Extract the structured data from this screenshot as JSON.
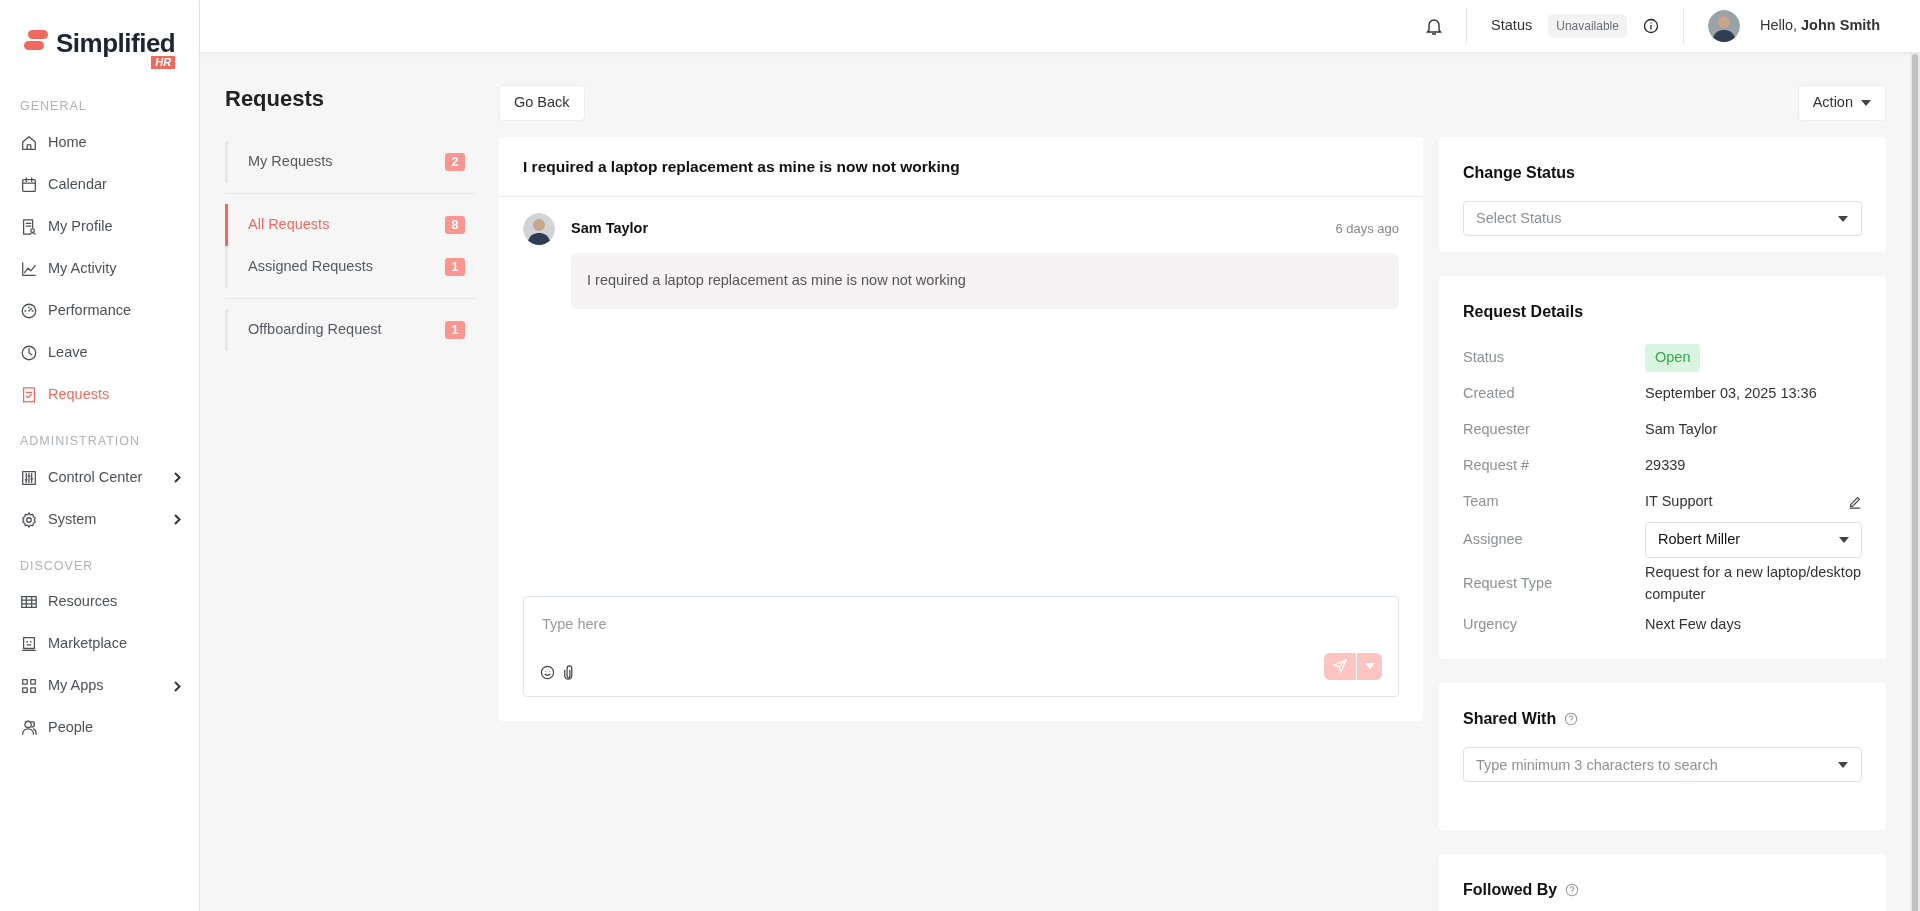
{
  "logo": {
    "name": "Simplified",
    "badge": "HR"
  },
  "sidebar": {
    "sections": [
      {
        "title": "GENERAL",
        "items": [
          {
            "label": "Home",
            "kind": "home",
            "selected": false,
            "expandable": false
          },
          {
            "label": "Calendar",
            "kind": "calendar",
            "selected": false,
            "expandable": false
          },
          {
            "label": "My Profile",
            "kind": "profile",
            "selected": false,
            "expandable": false
          },
          {
            "label": "My Activity",
            "kind": "activity",
            "selected": false,
            "expandable": false
          },
          {
            "label": "Performance",
            "kind": "gauge",
            "selected": false,
            "expandable": false
          },
          {
            "label": "Leave",
            "kind": "clock",
            "selected": false,
            "expandable": false
          },
          {
            "label": "Requests",
            "kind": "requests",
            "selected": true,
            "expandable": false
          }
        ]
      },
      {
        "title": "ADMINISTRATION",
        "items": [
          {
            "label": "Control Center",
            "kind": "sliders",
            "selected": false,
            "expandable": true
          },
          {
            "label": "System",
            "kind": "gear",
            "selected": false,
            "expandable": true
          }
        ]
      },
      {
        "title": "DISCOVER",
        "items": [
          {
            "label": "Resources",
            "kind": "table",
            "selected": false,
            "expandable": false
          },
          {
            "label": "Marketplace",
            "kind": "store",
            "selected": false,
            "expandable": false
          },
          {
            "label": "My Apps",
            "kind": "apps",
            "selected": false,
            "expandable": true
          },
          {
            "label": "People",
            "kind": "people",
            "selected": false,
            "expandable": false
          }
        ]
      }
    ]
  },
  "topbar": {
    "status_label": "Status",
    "status_value": "Unavailable",
    "greeting": "Hello, **John Smith**"
  },
  "requests_nav": {
    "title": "Requests",
    "groups": [
      [
        {
          "label": "My Requests",
          "count": "2",
          "selected": false
        }
      ],
      [
        {
          "label": "All Requests",
          "count": "8",
          "selected": true
        },
        {
          "label": "Assigned Requests",
          "count": "1",
          "selected": false
        }
      ],
      [
        {
          "label": "Offboarding Request",
          "count": "1",
          "selected": false
        }
      ]
    ]
  },
  "toolbar": {
    "back": "Go Back",
    "action": "Action"
  },
  "ticket": {
    "title": "I required a laptop replacement as mine is now not working",
    "messages": [
      {
        "author": "Sam Taylor",
        "time": "6 days ago",
        "text": "I required a laptop replacement as mine is now not working"
      }
    ],
    "composer": {
      "placeholder": "Type here",
      "send_disabled": true
    }
  },
  "change_status": {
    "title": "Change Status",
    "placeholder": "Select Status"
  },
  "details": {
    "title": "Request Details",
    "rows": [
      {
        "label": "Status",
        "value": "Open",
        "kind": "badge"
      },
      {
        "label": "Created",
        "value": "September 03, 2025 13:36",
        "kind": "text"
      },
      {
        "label": "Requester",
        "value": "Sam Taylor",
        "kind": "text"
      },
      {
        "label": "Request #",
        "value": "29339",
        "kind": "text"
      },
      {
        "label": "Team",
        "value": "IT Support",
        "kind": "editable"
      },
      {
        "label": "Assignee",
        "value": "Robert Miller",
        "kind": "select"
      },
      {
        "label": "Request Type",
        "value": "Request for a new laptop/desktop computer",
        "kind": "text"
      },
      {
        "label": "Urgency",
        "value": "Next Few days",
        "kind": "text"
      }
    ]
  },
  "shared_with": {
    "title": "Shared With",
    "placeholder": "Type minimum 3 characters to search"
  },
  "followed_by": {
    "title": "Followed By"
  }
}
